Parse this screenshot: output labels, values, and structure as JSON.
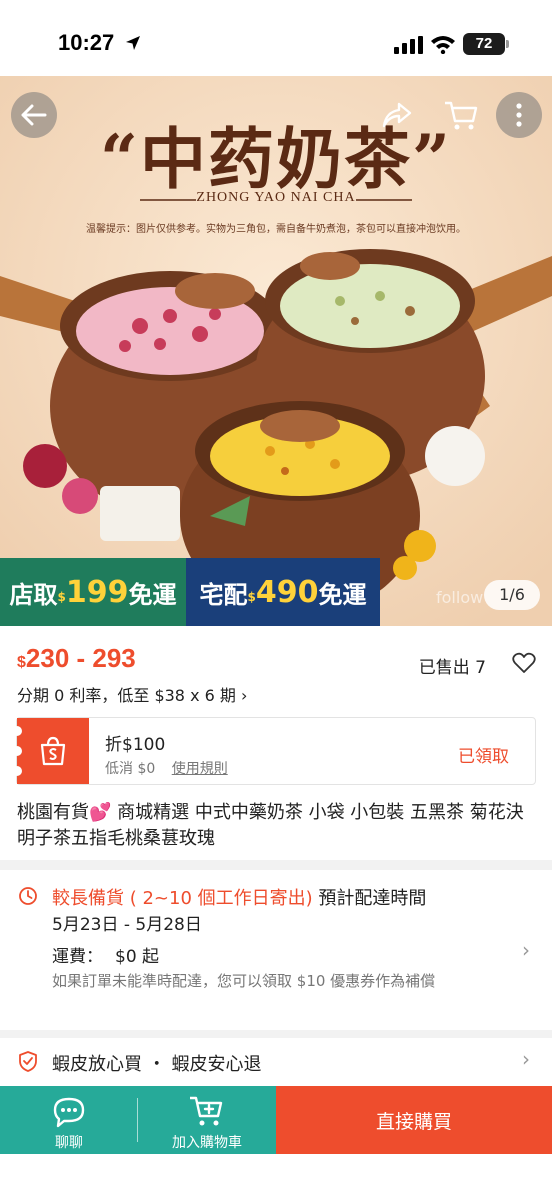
{
  "status_bar": {
    "time": "10:27",
    "battery": "72"
  },
  "hero": {
    "title": "“中药奶茶”",
    "subtitle": "ZHONG YAO NAI CHA",
    "note": "温馨提示：图片仅供参考。实物为三角包，需自备牛奶煮泡，茶包可以直接冲泡饮用。",
    "banner_pickup": {
      "label": "店取",
      "currency": "$",
      "amount": "199",
      "suffix": "免運"
    },
    "banner_delivery": {
      "label": "宅配",
      "currency": "$",
      "amount": "490",
      "suffix": "免運"
    },
    "watermark": "follow",
    "page_indicator": "1/6"
  },
  "price": {
    "currency": "$",
    "range": "230 - 293"
  },
  "sold": "已售出 7",
  "installment": "分期 0 利率，低至 $38 x 6 期 ›",
  "voucher": {
    "discount": "折$100",
    "min_spend": "低消 $0",
    "rules": "使用規則",
    "claimed": "已領取"
  },
  "product_title": "桃園有貨💕 商城精選 中式中藥奶茶 小袋 小包裝 五黑茶 菊花決明子茶五指毛桃桑葚玫瑰",
  "shipping": {
    "highlight": "較長備貨 ( 2~10 個工作日寄出)",
    "estimate_label": " 預計配達時間",
    "dates": "5月23日 - 5月28日",
    "fee_label": "運費：",
    "fee_value": "$0 起",
    "compensation": "如果訂單未能準時配達，您可以領取 $10 優惠券作為補償"
  },
  "guarantee": "蝦皮放心買 ・ 蝦皮安心退",
  "bottom_bar": {
    "chat": "聊聊",
    "add_to_cart": "加入購物車",
    "buy_now": "直接購買"
  },
  "colors": {
    "accent": "#ee4d2d",
    "teal": "#26aa99",
    "green_banner": "#1f7c5c",
    "blue_banner": "#1a3f7a"
  }
}
